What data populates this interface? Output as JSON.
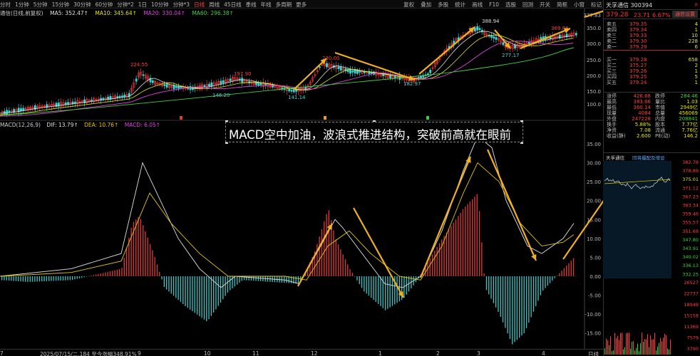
{
  "toolbar": {
    "periods": [
      "分时",
      "1分钟",
      "5分钟",
      "15分钟",
      "30分钟",
      "60分钟",
      "分钟*2",
      "1日",
      "10分钟",
      "分钟*3",
      "日线",
      "周线",
      "45日线",
      "季线",
      "年线",
      "多周期",
      "更多"
    ],
    "active_period": "日线",
    "tools": [
      "复权",
      "叠加",
      "多股",
      "统计",
      "画线",
      "F10",
      "选股",
      "回测",
      "开关",
      "简框",
      "小窗",
      "标记"
    ]
  },
  "ma": {
    "label": "通信(日线,前复权)",
    "ma5": "MA5: 352.47↑",
    "ma10": "MA10: 345.64↑",
    "ma20": "MA20: 330.04↑",
    "ma60": "MA60: 296.38↑",
    "ma5_color": "#e0e0e0",
    "ma10_color": "#e6e600",
    "ma20_color": "#e040e0",
    "ma60_color": "#40d040"
  },
  "price_axis": [
    "377.83",
    "350.0",
    "300.0",
    "250.0",
    "200.0",
    "150.0",
    "100.0"
  ],
  "price_marks": {
    "high1": "224.55",
    "high2": "197.90",
    "low1": "146.20",
    "low2": "141.14",
    "high3": "230.00",
    "low3": "182.97",
    "high4": "388.94",
    "low4": "277.17",
    "high5": "369.88"
  },
  "macd": {
    "label": "MACD(12,26,9)",
    "dif": "DIF: 13.79↑",
    "dea": "DEA: 10.76↑",
    "macd": "MACD: 6.05↑",
    "dif_color": "#e0e0e0",
    "dea_color": "#e6c800",
    "macd_color": "#e040e0",
    "axis": [
      "35.00",
      "30.00",
      "25.00",
      "20.00",
      "15.00",
      "10.00",
      "5.00",
      "0.00",
      "-5.00",
      "-10.00",
      "-15.00"
    ]
  },
  "banner": "MACD空中加油，波浪式推进结构，突破前高就在眼前",
  "panel": {
    "name": "天孚通信",
    "code": "300394",
    "badge": "R",
    "price": "379.28",
    "change": "23.71",
    "pct": "6.67%",
    "setting": "通信设置",
    "sell": [
      {
        "label": "卖五",
        "price": "379.35",
        "vol": "4"
      },
      {
        "label": "卖四",
        "price": "379.34",
        "vol": "1"
      },
      {
        "label": "卖三",
        "price": "379.33",
        "vol": "10"
      },
      {
        "label": "卖二",
        "price": "379.30",
        "vol": "228"
      },
      {
        "label": "卖一",
        "price": "379.29",
        "vol": "6"
      }
    ],
    "buy": [
      {
        "label": "买一",
        "price": "379.28",
        "vol": "658"
      },
      {
        "label": "买二",
        "price": "375.27",
        "vol": "2"
      },
      {
        "label": "买三",
        "price": "379.26",
        "vol": "1"
      },
      {
        "label": "买四",
        "price": "379.25",
        "vol": "5"
      },
      {
        "label": "买五",
        "price": "379.24",
        "vol": "1"
      }
    ],
    "stats": [
      {
        "k1": "涨停",
        "v1": "426.68",
        "k2": "跌停",
        "v2": "284.46"
      },
      {
        "k1": "最高",
        "v1": "383.66",
        "k2": "量比",
        "v2": "1.03"
      },
      {
        "k1": "最低",
        "v1": "360.14",
        "k2": "市值",
        "v2": "2949亿"
      },
      {
        "k1": "现量",
        "v1": "4084",
        "k2": "总量",
        "v2": "456069"
      },
      {
        "k1": "外盘",
        "v1": "247228",
        "k2": "内盘",
        "v2": "208841"
      },
      {
        "k1": "换手",
        "v1": "5.88%",
        "k2": "股本",
        "v2": "7.77亿"
      },
      {
        "k1": "净资",
        "v1": "7.08",
        "k2": "流通",
        "v2": "7.76亿"
      },
      {
        "k1": "收益(静)",
        "v1": "2.600",
        "k2": "PE(动)",
        "v2": "146.2"
      }
    ],
    "mini_title": "天孚通信",
    "mini_tab": "同将撮配及增设",
    "mini_axis": [
      "382.78",
      "378.89",
      "375.01",
      "371.12",
      "367.23",
      "363.34",
      "359.46",
      "355.57",
      "351.68",
      "347.80",
      "343.91",
      "340.02",
      "336.13",
      "332.25",
      "26527",
      "22737",
      "18948",
      "15158",
      "11369",
      "7579",
      "3790"
    ]
  },
  "dates": {
    "items": [
      "7",
      "2025/07/15/二,184  至今涨幅348.91%",
      "9",
      "10",
      "11",
      "12",
      "1",
      "2",
      "3",
      "4"
    ],
    "right": "日线"
  }
}
